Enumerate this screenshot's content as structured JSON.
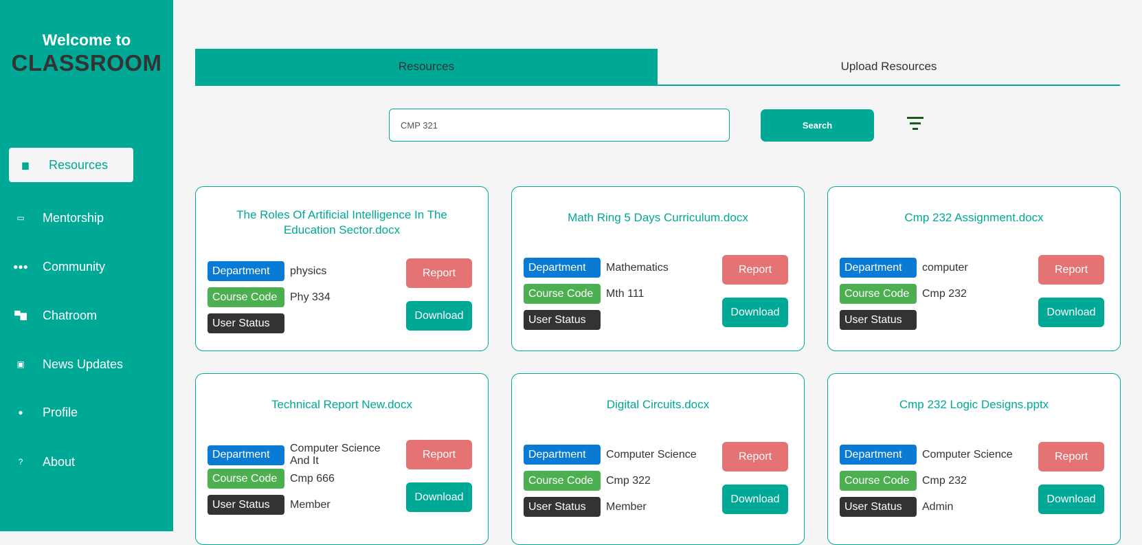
{
  "sidebar": {
    "welcome": "Welcome to",
    "brand": "CLASSROOM",
    "items": [
      {
        "label": "Resources",
        "icon": "file-icon"
      },
      {
        "label": "Mentorship",
        "icon": "chalkboard-teacher-icon"
      },
      {
        "label": "Community",
        "icon": "users-icon"
      },
      {
        "label": "Chatroom",
        "icon": "comments-icon"
      },
      {
        "label": "News Updates",
        "icon": "newspaper-icon"
      },
      {
        "label": "Profile",
        "icon": "user-circle-icon"
      },
      {
        "label": "About",
        "icon": "question-circle-icon"
      }
    ]
  },
  "tabs": [
    {
      "label": "Resources"
    },
    {
      "label": "Upload Resources"
    }
  ],
  "search": {
    "value": "CMP 321",
    "button": "Search"
  },
  "labels": {
    "department": "Department",
    "course_code": "Course Code",
    "user_status": "User Status",
    "report": "Report",
    "download": "Download"
  },
  "colors": {
    "accent": "#00a896",
    "department": "#0a7bd4",
    "course_code": "#4caf50",
    "user_status": "#333333",
    "report": "#e57373"
  },
  "cards": [
    {
      "title": "The Roles Of Artificial Intelligence In The Education Sector.docx",
      "department": "physics",
      "course_code": "Phy 334",
      "user_status": ""
    },
    {
      "title": "Math Ring 5 Days Curriculum.docx",
      "department": "Mathematics",
      "course_code": "Mth 111",
      "user_status": ""
    },
    {
      "title": "Cmp 232 Assignment.docx",
      "department": "computer",
      "course_code": "Cmp 232",
      "user_status": ""
    },
    {
      "title": "Technical Report New.docx",
      "department": "Computer Science And It",
      "course_code": "Cmp 666",
      "user_status": "Member"
    },
    {
      "title": "Digital Circuits.docx",
      "department": "Computer Science",
      "course_code": "Cmp 322",
      "user_status": "Member"
    },
    {
      "title": "Cmp 232 Logic Designs.pptx",
      "department": "Computer Science",
      "course_code": "Cmp 232",
      "user_status": "Admin"
    }
  ]
}
